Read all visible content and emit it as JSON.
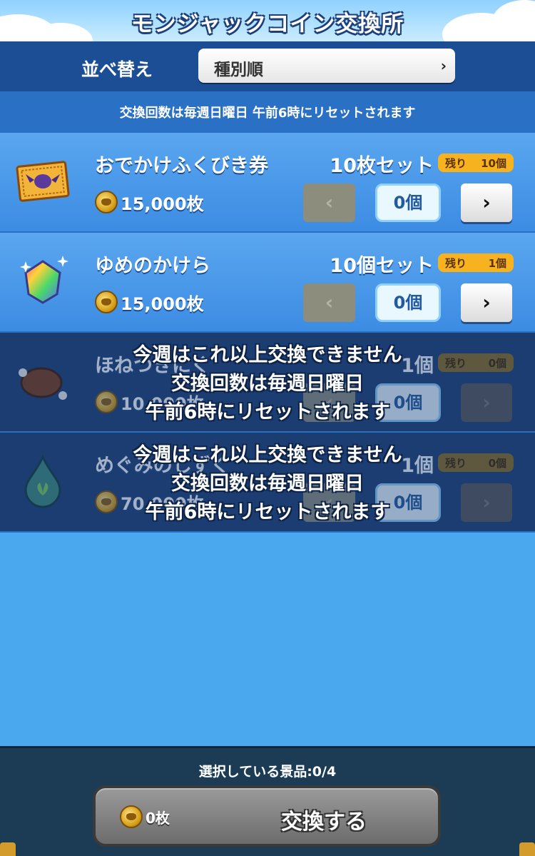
{
  "header": {
    "title": "モンジャックコイン交換所"
  },
  "sort": {
    "label": "並べ替え",
    "value": "種別順",
    "chevron": "›"
  },
  "info": {
    "reset_text": "交換回数は毎週日曜日 午前6時にリセットされます"
  },
  "items": [
    {
      "name": "おでかけふくびき券",
      "set": "10枚セット",
      "remain_label": "残り",
      "remain_value": "10個",
      "cost": "15,000枚",
      "quantity": "0個",
      "prev": "‹",
      "next": "›",
      "icon": "ticket-icon",
      "disabled": false
    },
    {
      "name": "ゆめのかけら",
      "set": "10個セット",
      "remain_label": "残り",
      "remain_value": "1個",
      "cost": "15,000枚",
      "quantity": "0個",
      "prev": "‹",
      "next": "›",
      "icon": "rainbow-gem-icon",
      "disabled": false
    },
    {
      "name": "ほねつきにく",
      "set": "1個",
      "remain_label": "残り",
      "remain_value": "0個",
      "cost": "10,000枚",
      "quantity": "0個",
      "prev": "‹",
      "next": "›",
      "icon": "meat-icon",
      "disabled": true,
      "overlay": [
        "今週はこれ以上交換できません",
        "交換回数は毎週日曜日",
        "午前6時にリセットされます"
      ]
    },
    {
      "name": "めぐみのしずく",
      "set": "1個",
      "remain_label": "残り",
      "remain_value": "0個",
      "cost": "70,000枚",
      "quantity": "0個",
      "prev": "‹",
      "next": "›",
      "icon": "drop-icon",
      "disabled": true,
      "overlay": [
        "今週はこれ以上交換できません",
        "交換回数は毎週日曜日",
        "午前6時にリセットされます"
      ]
    }
  ],
  "footer": {
    "selected": "選択している景品:0/4",
    "coin_total": "0枚",
    "exchange_label": "交換する"
  },
  "colors": {
    "background": "#4aa8ee",
    "header_bar": "#1b4e94",
    "remain_badge": "#f6b21f",
    "footer": "#1c3b55"
  }
}
